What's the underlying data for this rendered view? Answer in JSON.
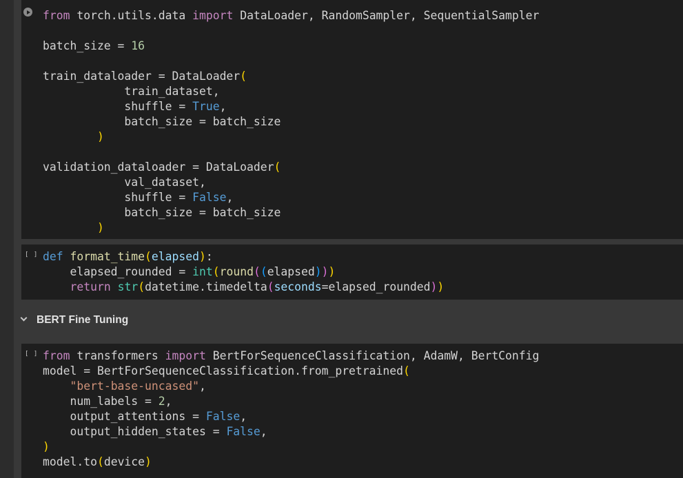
{
  "cells": [
    {
      "run_icon": "play-icon",
      "lines": [
        [
          [
            "kw",
            "from"
          ],
          [
            "txt",
            " torch.utils.data "
          ],
          [
            "kw",
            "import"
          ],
          [
            "txt",
            " DataLoader, RandomSampler, SequentialSampler"
          ]
        ],
        [],
        [
          [
            "txt",
            "batch_size = "
          ],
          [
            "nm",
            "16"
          ]
        ],
        [],
        [
          [
            "txt",
            "train_dataloader = DataLoader"
          ],
          [
            "p1",
            "("
          ]
        ],
        [
          [
            "txt",
            "            train_dataset,"
          ]
        ],
        [
          [
            "txt",
            "            shuffle = "
          ],
          [
            "bk",
            "True"
          ],
          [
            "txt",
            ","
          ]
        ],
        [
          [
            "txt",
            "            batch_size = batch_size"
          ]
        ],
        [
          [
            "p1",
            "        )"
          ]
        ],
        [],
        [
          [
            "txt",
            "validation_dataloader = DataLoader"
          ],
          [
            "p1",
            "("
          ]
        ],
        [
          [
            "txt",
            "            val_dataset,"
          ]
        ],
        [
          [
            "txt",
            "            shuffle = "
          ],
          [
            "bk",
            "False"
          ],
          [
            "txt",
            ","
          ]
        ],
        [
          [
            "txt",
            "            batch_size = batch_size"
          ]
        ],
        [
          [
            "p1",
            "        )"
          ]
        ]
      ]
    },
    {
      "run_icon": "brackets-icon",
      "brackets_text": "[ ]",
      "lines": [
        [
          [
            "bk",
            "def"
          ],
          [
            "txt",
            " "
          ],
          [
            "fn",
            "format_time"
          ],
          [
            "p1",
            "("
          ],
          [
            "pr",
            "elapsed"
          ],
          [
            "p1",
            ")"
          ],
          [
            "txt",
            ":"
          ]
        ],
        [
          [
            "txt",
            "    elapsed_rounded = "
          ],
          [
            "bi",
            "int"
          ],
          [
            "p1",
            "("
          ],
          [
            "fn",
            "round"
          ],
          [
            "p2",
            "("
          ],
          [
            "p3",
            "("
          ],
          [
            "txt",
            "elapsed"
          ],
          [
            "p3",
            ")"
          ],
          [
            "p2",
            ")"
          ],
          [
            "p1",
            ")"
          ]
        ],
        [
          [
            "txt",
            "    "
          ],
          [
            "kw",
            "return"
          ],
          [
            "txt",
            " "
          ],
          [
            "bi",
            "str"
          ],
          [
            "p1",
            "("
          ],
          [
            "txt",
            "datetime.timedelta"
          ],
          [
            "p2",
            "("
          ],
          [
            "pr",
            "seconds"
          ],
          [
            "txt",
            "=elapsed_rounded"
          ],
          [
            "p2",
            ")"
          ],
          [
            "p1",
            ")"
          ]
        ]
      ]
    },
    {
      "run_icon": "brackets-icon",
      "brackets_text": "[ ]",
      "lines": [
        [
          [
            "kw",
            "from"
          ],
          [
            "txt",
            " transformers "
          ],
          [
            "kw",
            "import"
          ],
          [
            "txt",
            " BertForSequenceClassification, AdamW, BertConfig"
          ]
        ],
        [
          [
            "txt",
            "model = BertForSequenceClassification.from_pretrained"
          ],
          [
            "p1",
            "("
          ]
        ],
        [
          [
            "txt",
            "    "
          ],
          [
            "st",
            "\"bert-base-uncased\""
          ],
          [
            "txt",
            ","
          ]
        ],
        [
          [
            "txt",
            "    num_labels = "
          ],
          [
            "nm",
            "2"
          ],
          [
            "txt",
            ","
          ]
        ],
        [
          [
            "txt",
            "    output_attentions = "
          ],
          [
            "bk",
            "False"
          ],
          [
            "txt",
            ","
          ]
        ],
        [
          [
            "txt",
            "    output_hidden_states = "
          ],
          [
            "bk",
            "False"
          ],
          [
            "txt",
            ","
          ]
        ],
        [
          [
            "p1",
            ")"
          ]
        ],
        [
          [
            "txt",
            "model.to"
          ],
          [
            "p1",
            "("
          ],
          [
            "txt",
            "device"
          ],
          [
            "p1",
            ")"
          ]
        ]
      ]
    }
  ],
  "section": {
    "title": "BERT Fine Tuning",
    "icon": "chevron-down-icon"
  },
  "colors": {
    "keyword": "#c586c0",
    "builtin_const": "#569cd6",
    "function": "#dcdcaa",
    "number": "#b5cea8",
    "string": "#ce9178",
    "bracket_1": "#ffd700",
    "bracket_2": "#da70d6",
    "bracket_3": "#179fff"
  }
}
